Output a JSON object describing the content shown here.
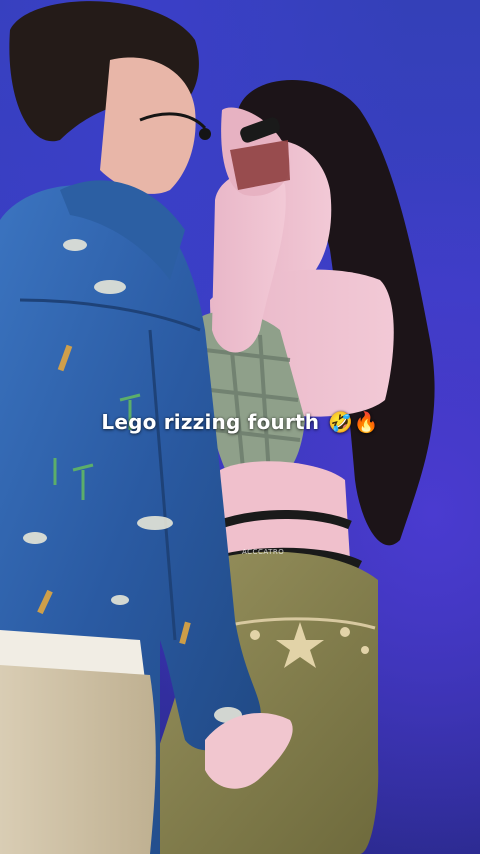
{
  "caption": {
    "text": "Lego rizzing fourth",
    "emojis": "🤣🔥"
  },
  "watermark": {
    "text": "ACCCATRO"
  },
  "scene": {
    "background_color": "#3a3ec4",
    "jacket_color": "#2f62a8",
    "pants_color": "#8a8452"
  }
}
